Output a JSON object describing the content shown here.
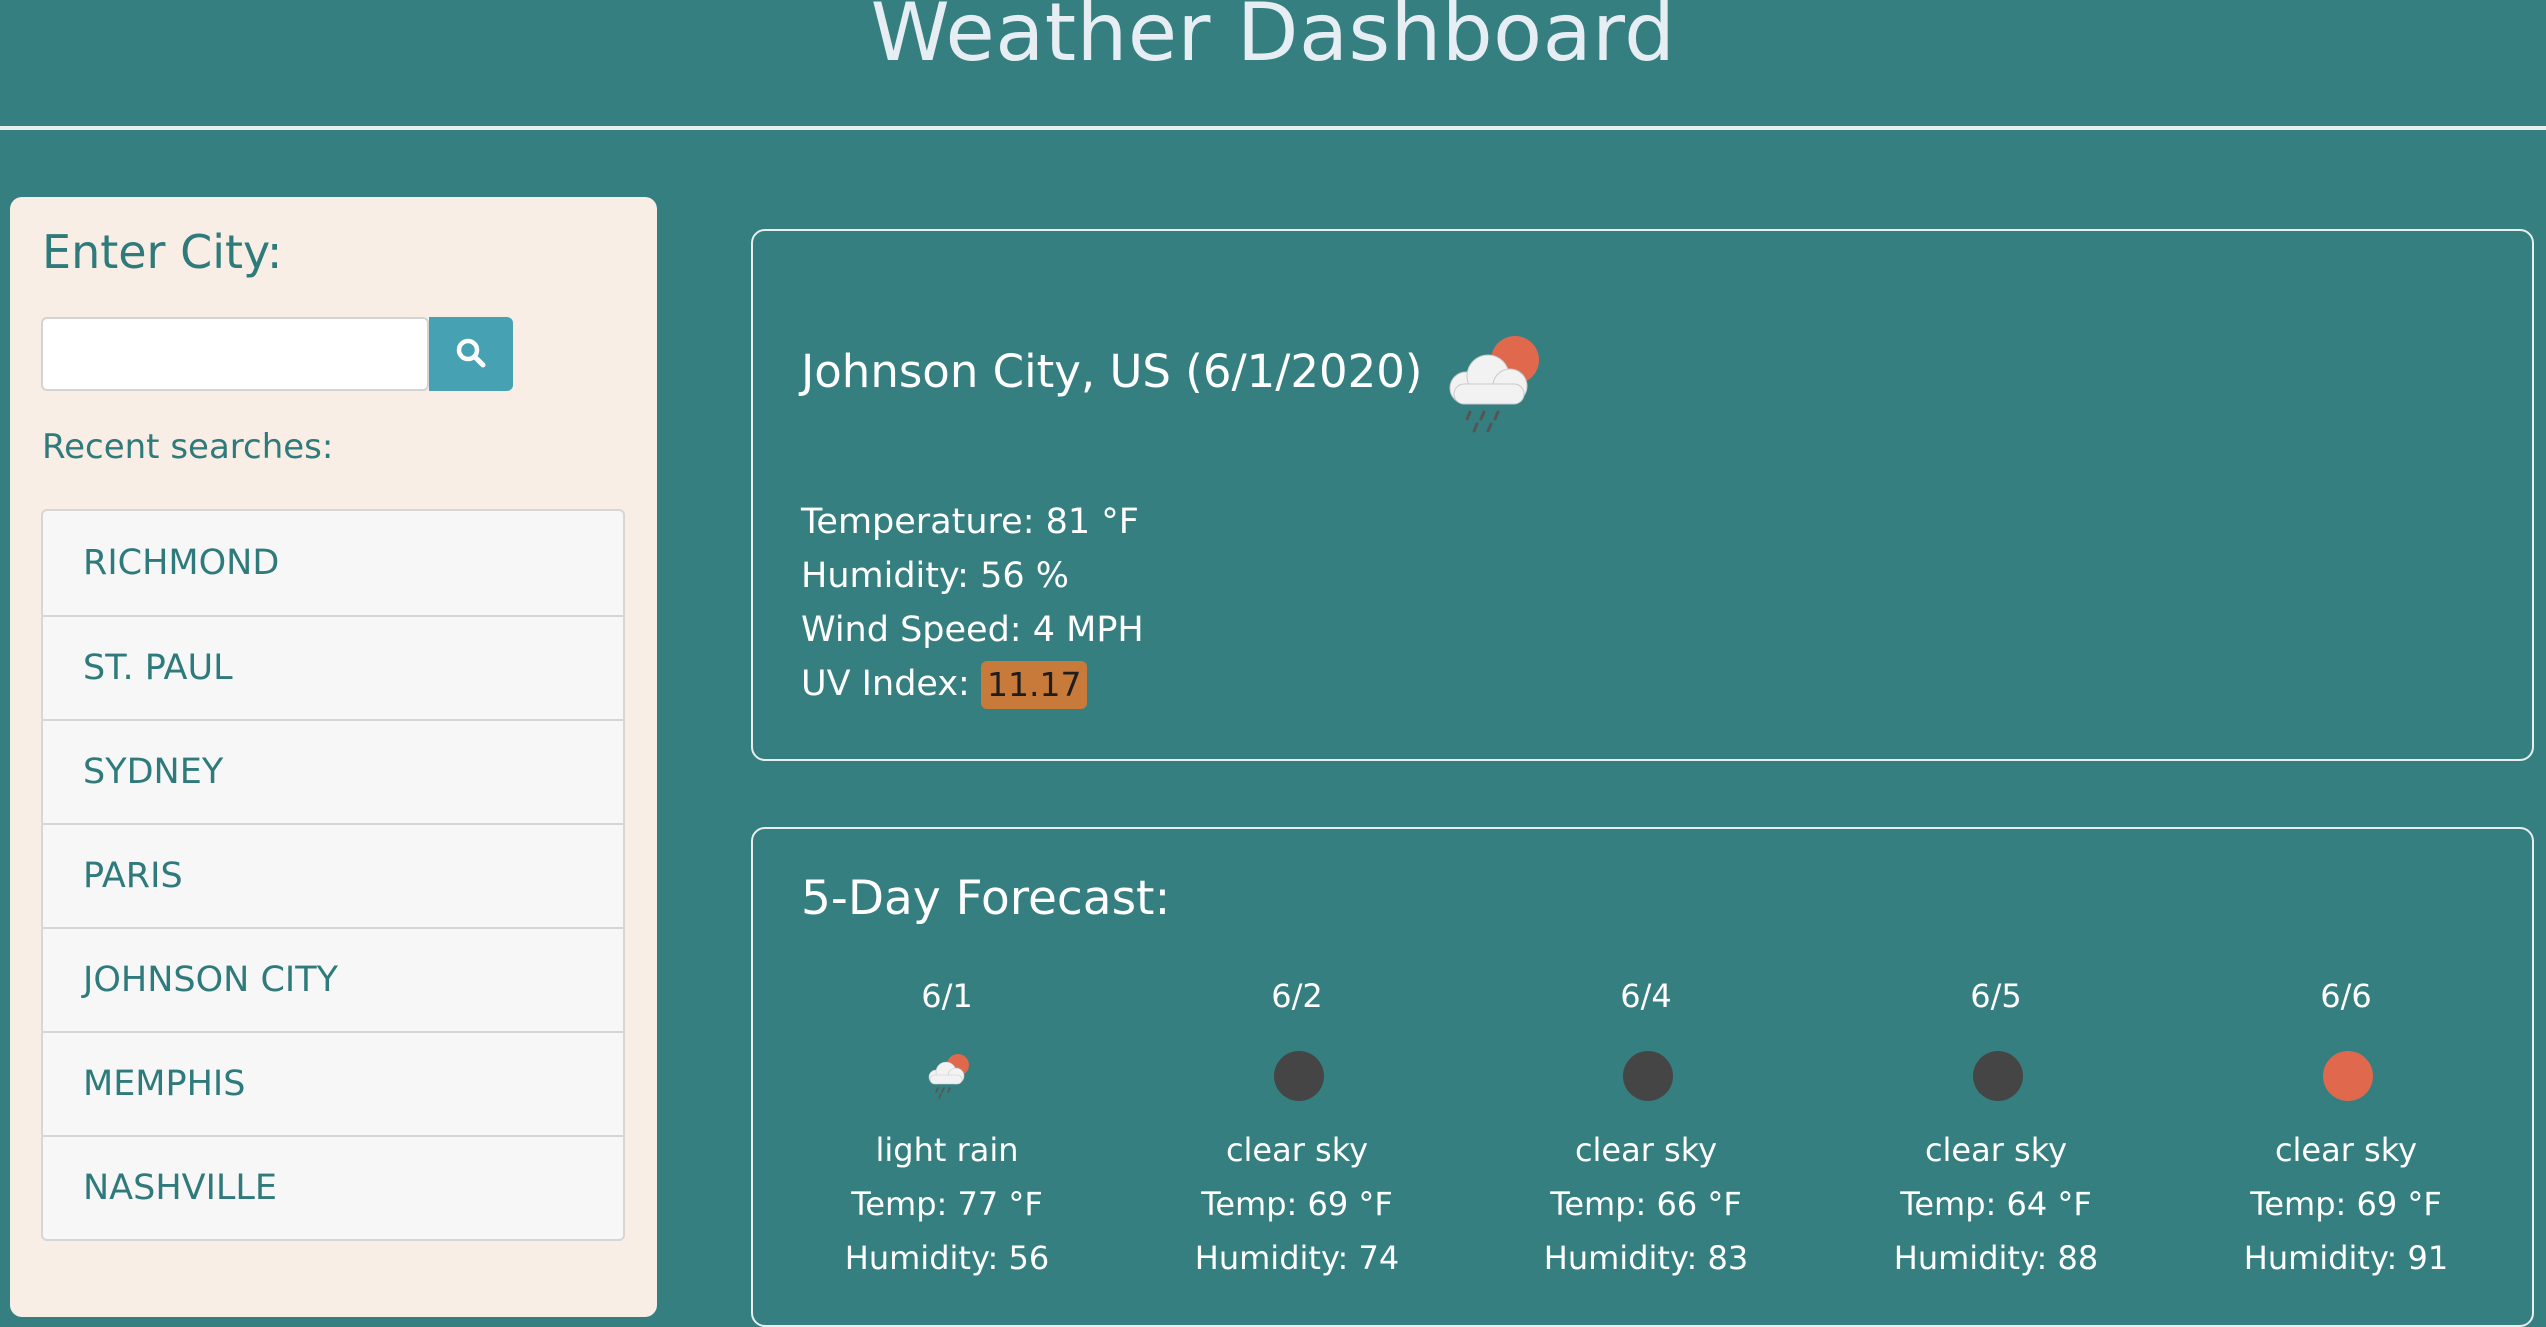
{
  "header": {
    "title": "Weather Dashboard"
  },
  "sidebar": {
    "enter_label": "Enter City:",
    "search_value": "",
    "recent_label": "Recent searches:",
    "recent": [
      "RICHMOND",
      "ST. PAUL",
      "SYDNEY",
      "PARIS",
      "JOHNSON CITY",
      "MEMPHIS",
      "NASHVILLE"
    ]
  },
  "current": {
    "title": "Johnson City, US (6/1/2020)",
    "icon": "rain-cloud-sun-icon",
    "temperature": "Temperature: 81 °F",
    "humidity": "Humidity: 56 %",
    "wind": "Wind Speed: 4 MPH",
    "uv_label": "UV Index: ",
    "uv_value": "11.17",
    "uv_color": "#c87a3a"
  },
  "forecast": {
    "title": "5-Day Forecast:",
    "days": [
      {
        "date": "6/1",
        "icon": "rain-cloud-sun-icon",
        "desc": "light rain",
        "temp": "Temp: 77 °F",
        "humidity": "Humidity: 56"
      },
      {
        "date": "6/2",
        "icon": "clear-night-icon",
        "desc": "clear sky",
        "temp": "Temp: 69 °F",
        "humidity": "Humidity: 74"
      },
      {
        "date": "6/4",
        "icon": "clear-night-icon",
        "desc": "clear sky",
        "temp": "Temp: 66 °F",
        "humidity": "Humidity: 83"
      },
      {
        "date": "6/5",
        "icon": "clear-night-icon",
        "desc": "clear sky",
        "temp": "Temp: 64 °F",
        "humidity": "Humidity: 88"
      },
      {
        "date": "6/6",
        "icon": "clear-day-sun-icon",
        "desc": "clear sky",
        "temp": "Temp: 69 °F",
        "humidity": "Humidity: 91"
      }
    ]
  },
  "colors": {
    "background": "#367f80",
    "sidebar": "#f8eee6",
    "accent_text": "#2f7a7b",
    "search_button": "#46a1b3",
    "sun": "#e0694d",
    "moon": "#454545"
  }
}
